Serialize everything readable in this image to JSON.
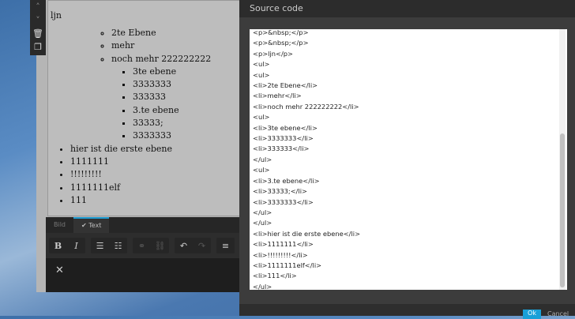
{
  "editor": {
    "paragraph": "ljn",
    "level2": [
      "2te Ebene",
      "mehr",
      "noch mehr 222222222"
    ],
    "level3a": [
      "3te ebene",
      "3333333",
      "333333"
    ],
    "level3b": [
      "3.te ebene",
      "33333;",
      "3333333"
    ],
    "level1": [
      "hier ist die erste ebene",
      "1111111",
      "!!!!!!!!!",
      "1111111elf",
      "111"
    ]
  },
  "toolbar": {
    "tabs": [
      "Bild",
      "Text"
    ],
    "check": "✔"
  },
  "dialog": {
    "title": "Source code",
    "ok": "Ok",
    "cancel": "Cancel",
    "code": "<p>&nbsp;</p>\n<p>&nbsp;</p>\n<p>ljn</p>\n<ul>\n<ul>\n<li>2te Ebene</li>\n<li>mehr</li>\n<li>noch mehr 222222222</li>\n<ul>\n<li>3te ebene</li>\n<li>3333333</li>\n<li>333333</li>\n</ul>\n<ul>\n<li>3.te ebene</li>\n<li>33333;</li>\n<li>3333333</li>\n</ul>\n</ul>\n<li>hier ist die erste ebene</li>\n<li>1111111</li>\n<li>!!!!!!!!!</li>\n<li>1111111elf</li>\n<li>111</li>\n</ul>"
  }
}
